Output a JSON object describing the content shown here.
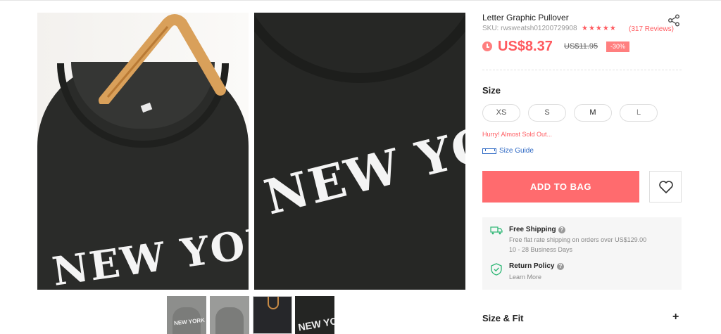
{
  "product": {
    "title": "Letter Graphic Pullover",
    "sku": "SKU: rwsweatsh01200729908",
    "stars": "★★★★★",
    "reviews": "(317 Reviews)",
    "price": "US$8.37",
    "old_price": "US$11.95",
    "discount": "-30%"
  },
  "gallery": {
    "print_text": "NEW YORK",
    "thumb_text": "NEW YORK"
  },
  "size": {
    "label": "Size",
    "options": [
      "XS",
      "S",
      "M",
      "L"
    ],
    "stock_note": "Hurry! Almost Sold Out...",
    "guide_label": "Size Guide"
  },
  "actions": {
    "add_to_bag": "ADD TO BAG"
  },
  "shipping": {
    "title": "Free Shipping",
    "desc": "Free flat rate shipping on orders over US$129.00",
    "days": "10 - 28 Business Days",
    "return_title": "Return Policy",
    "learn_more": "Learn More",
    "help_glyph": "?"
  },
  "sections": {
    "size_fit": "Size & Fit",
    "expand_glyph": "+"
  },
  "colors": {
    "accent": "#ff5a5f",
    "button": "#ff6b6e",
    "link": "#2d68c4"
  },
  "icons": [
    "share-icon",
    "clock-icon",
    "heart-icon",
    "truck-icon",
    "shield-icon",
    "ruler-icon"
  ]
}
